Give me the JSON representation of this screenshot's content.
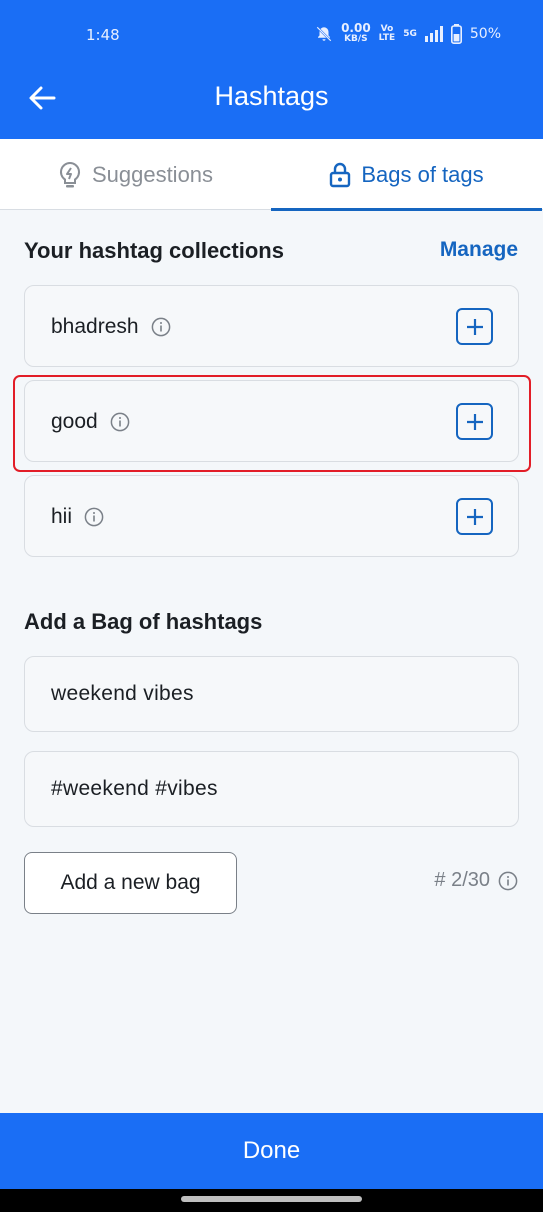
{
  "status_bar": {
    "time": "1:48",
    "net_speed_value": "0.00",
    "net_speed_unit": "KB/S",
    "volte_top": "Vo",
    "volte_bottom": "LTE",
    "network": "5G",
    "battery": "50%"
  },
  "header": {
    "title": "Hashtags",
    "back_icon": "arrow-left-icon"
  },
  "tabs": [
    {
      "label": "Suggestions",
      "icon": "lightbulb-icon",
      "selected": false
    },
    {
      "label": "Bags of tags",
      "icon": "lock-icon",
      "selected": true
    }
  ],
  "collections": {
    "heading": "Your hashtag collections",
    "manage_label": "Manage",
    "items": [
      {
        "name": "bhadresh"
      },
      {
        "name": "good"
      },
      {
        "name": "hii"
      }
    ]
  },
  "add_bag": {
    "heading": "Add a Bag of hashtags",
    "name_value": "weekend vibes",
    "tags_value": "#weekend #vibes",
    "button_label": "Add a new bag",
    "count_label": "# 2/30"
  },
  "footer": {
    "done_label": "Done"
  },
  "colors": {
    "primary": "#1a6ef5",
    "accent_text": "#1565c0",
    "highlight": "#e21d27"
  }
}
